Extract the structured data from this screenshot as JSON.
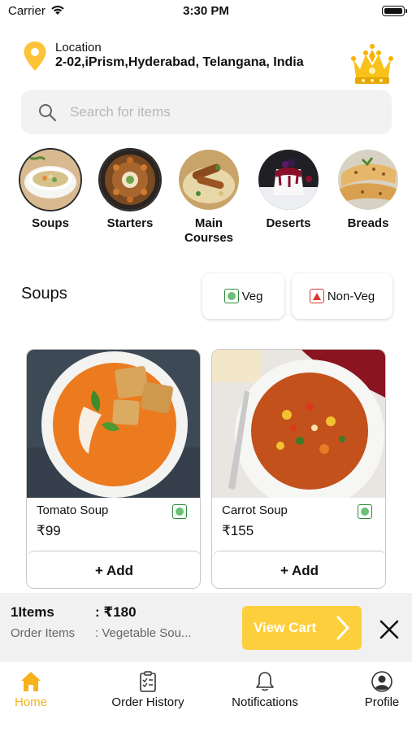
{
  "status_bar": {
    "carrier": "Carrier",
    "time": "3:30 PM"
  },
  "location": {
    "label": "Location",
    "value": "2-02,iPrism,Hyderabad, Telangana, India"
  },
  "search": {
    "placeholder": "Search for items",
    "value": ""
  },
  "categories": [
    {
      "label": "Soups",
      "icon": "soup-image",
      "selected": true
    },
    {
      "label": "Starters",
      "icon": "starters-image"
    },
    {
      "label": "Main Courses",
      "icon": "main-courses-image"
    },
    {
      "label": "Deserts",
      "icon": "deserts-image"
    },
    {
      "label": "Breads",
      "icon": "breads-image"
    }
  ],
  "section": {
    "title": "Soups"
  },
  "filters": {
    "veg": "Veg",
    "non_veg": "Non-Veg"
  },
  "items": [
    {
      "name": "Tomato Soup",
      "price": "₹99",
      "add_label": "+ Add",
      "type": "veg"
    },
    {
      "name": "Carrot Soup",
      "price": "₹155",
      "add_label": "+ Add",
      "type": "veg"
    }
  ],
  "cart": {
    "count": "1Items",
    "total": ": ₹180",
    "order_label": "Order Items",
    "order_value": ": Vegetable Sou...",
    "view_cart": "View Cart"
  },
  "tabs": [
    {
      "label": "Home",
      "icon": "home-icon",
      "active": true
    },
    {
      "label": "Order History",
      "icon": "clipboard-icon"
    },
    {
      "label": "Notifications",
      "icon": "bell-icon"
    },
    {
      "label": "Profile",
      "icon": "profile-icon"
    }
  ],
  "colors": {
    "accent": "#fecf3c",
    "active_tab": "#f6b21a",
    "veg": "#2c8d3a",
    "non_veg": "#dd3333"
  }
}
